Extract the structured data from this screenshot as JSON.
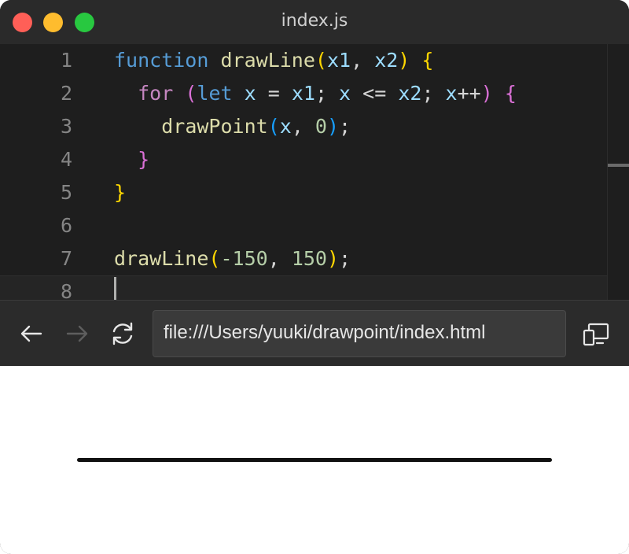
{
  "window": {
    "title": "index.js"
  },
  "editor": {
    "line_numbers": [
      "1",
      "2",
      "3",
      "4",
      "5",
      "6",
      "7",
      "8"
    ],
    "lines": [
      {
        "tokens": [
          "function",
          " ",
          "drawLine",
          "(",
          "x1",
          ", ",
          "x2",
          ")",
          " ",
          "{"
        ]
      },
      {
        "tokens": [
          "  ",
          "for",
          " ",
          "(",
          "let",
          " ",
          "x",
          " = ",
          "x1",
          "; ",
          "x",
          " <= ",
          "x2",
          "; ",
          "x",
          "++",
          ")",
          " ",
          "{"
        ]
      },
      {
        "tokens": [
          "    ",
          "drawPoint",
          "(",
          "x",
          ", ",
          "0",
          ")",
          ";"
        ]
      },
      {
        "tokens": [
          "  ",
          "}"
        ]
      },
      {
        "tokens": [
          "}"
        ]
      },
      {
        "tokens": []
      },
      {
        "tokens": [
          "drawLine",
          "(",
          "-150",
          ", ",
          "150",
          ")",
          ";"
        ]
      },
      {
        "tokens": []
      }
    ]
  },
  "browser": {
    "url": "file:///Users/yuuki/drawpoint/index.html",
    "back_icon": "arrow-left-icon",
    "forward_icon": "arrow-right-icon",
    "reload_icon": "reload-icon",
    "devices_icon": "device-toggle-icon"
  },
  "colors": {
    "keyword": "#569cd6",
    "function": "#dcdcaa",
    "variable": "#9cdcfe",
    "control": "#c586c0",
    "number": "#b5cea8",
    "bracket_level_1": "#ffd700",
    "bracket_level_2": "#da70d6",
    "bracket_level_3": "#179fff"
  }
}
